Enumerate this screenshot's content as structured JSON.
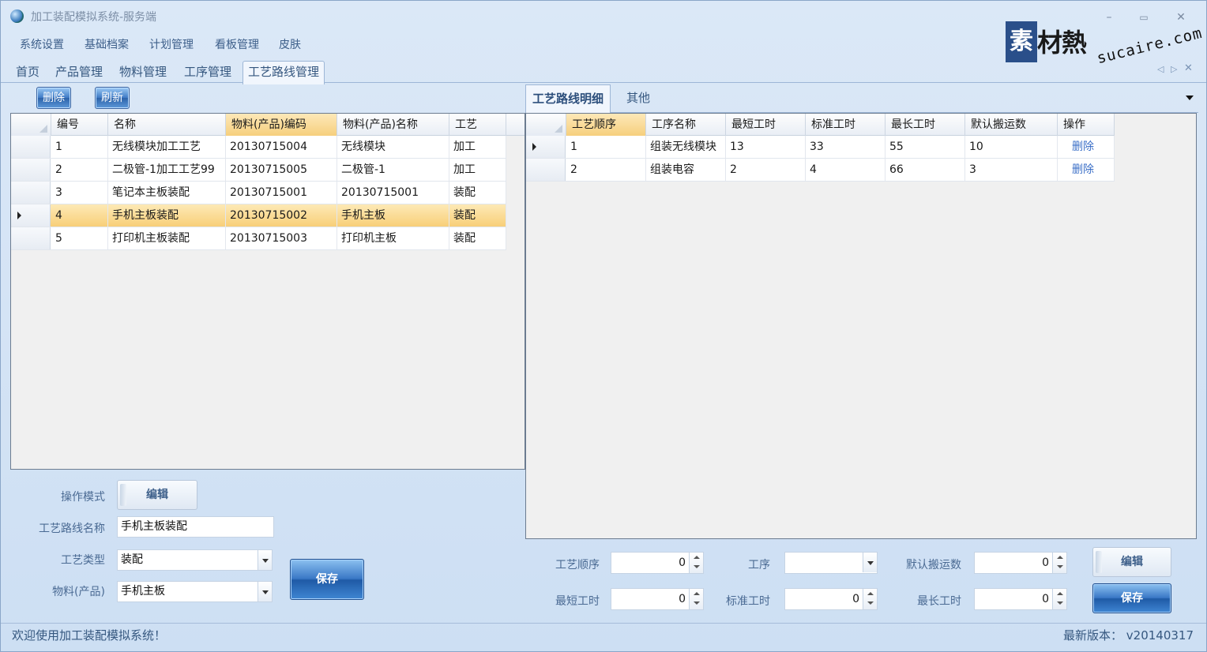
{
  "window": {
    "title": "加工装配模拟系统-服务端"
  },
  "logo": {
    "box_char": "素",
    "rest": "材熱",
    "url": "sucaire.com"
  },
  "menu": [
    "系统设置",
    "基础档案",
    "计划管理",
    "看板管理",
    "皮肤"
  ],
  "tabs": [
    "首页",
    "产品管理",
    "物料管理",
    "工序管理",
    "工艺路线管理"
  ],
  "active_tab": "工艺路线管理",
  "toolbar": {
    "delete_label": "删除",
    "refresh_label": "刷新"
  },
  "left_grid": {
    "columns": [
      "编号",
      "名称",
      "物料(产品)编码",
      "物料(产品)名称",
      "工艺"
    ],
    "rows": [
      [
        "1",
        "无线模块加工工艺",
        "20130715004",
        "无线模块",
        "加工"
      ],
      [
        "2",
        "二极管-1加工工艺99",
        "20130715005",
        "二极管-1",
        "加工"
      ],
      [
        "3",
        "笔记本主板装配",
        "20130715001",
        "20130715001",
        "装配"
      ],
      [
        "4",
        "手机主板装配",
        "20130715002",
        "手机主板",
        "装配"
      ],
      [
        "5",
        "打印机主板装配",
        "20130715003",
        "打印机主板",
        "装配"
      ]
    ],
    "selected_row": 4
  },
  "left_form": {
    "mode_label": "操作模式",
    "mode_button": "编辑",
    "route_name_label": "工艺路线名称",
    "route_name_value": "手机主板装配",
    "process_type_label": "工艺类型",
    "process_type_value": "装配",
    "material_label": "物料(产品)",
    "material_value": "手机主板",
    "save_label": "保存"
  },
  "right_tabs": [
    "工艺路线明细",
    "其他"
  ],
  "right_grid": {
    "columns": [
      "工艺顺序",
      "工序名称",
      "最短工时",
      "标准工时",
      "最长工时",
      "默认搬运数",
      "操作"
    ],
    "rows": [
      [
        "1",
        "组装无线模块",
        "13",
        "33",
        "55",
        "10",
        "删除"
      ],
      [
        "2",
        "组装电容",
        "2",
        "4",
        "66",
        "3",
        "删除"
      ]
    ],
    "selected_row": 1
  },
  "right_form": {
    "seq_label": "工艺顺序",
    "seq_value": "0",
    "proc_label": "工序",
    "proc_value": "",
    "carry_label": "默认搬运数",
    "carry_value": "0",
    "edit_label": "编辑",
    "min_label": "最短工时",
    "min_value": "0",
    "std_label": "标准工时",
    "std_value": "0",
    "max_label": "最长工时",
    "max_value": "0",
    "save_label": "保存"
  },
  "status": {
    "message": "欢迎使用加工装配模拟系统！",
    "version": "最新版本： v20140317"
  }
}
